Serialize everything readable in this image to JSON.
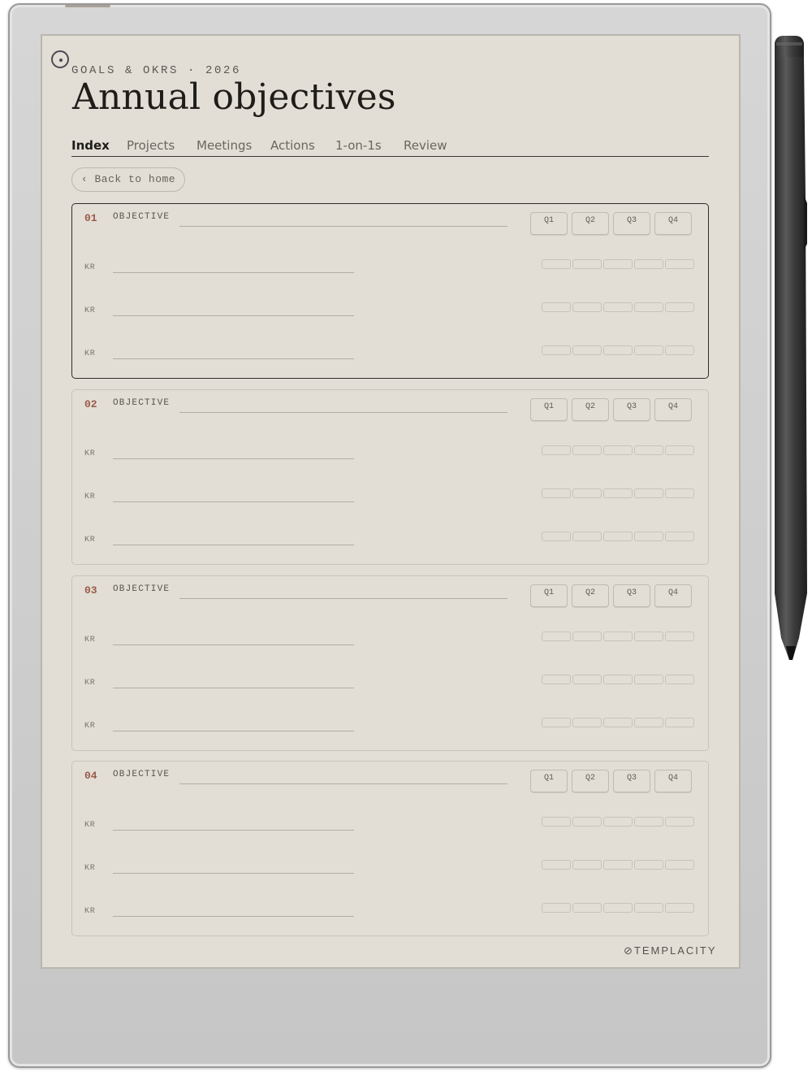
{
  "header": {
    "eyebrow": "GOALS & OKRS · 2026",
    "title": "Annual objectives"
  },
  "tabs": [
    {
      "label": "Index",
      "active": true
    },
    {
      "label": "Projects",
      "active": false
    },
    {
      "label": "Meetings",
      "active": false
    },
    {
      "label": "Actions",
      "active": false
    },
    {
      "label": "1-on-1s",
      "active": false
    },
    {
      "label": "Review",
      "active": false
    }
  ],
  "back_button": {
    "label": "‹ Back to home"
  },
  "objectives": [
    {
      "number": "01",
      "label": "OBJECTIVE",
      "quarters": [
        "Q1",
        "Q2",
        "Q3",
        "Q4"
      ],
      "kr_labels": [
        "KR",
        "KR",
        "KR"
      ]
    },
    {
      "number": "02",
      "label": "OBJECTIVE",
      "quarters": [
        "Q1",
        "Q2",
        "Q3",
        "Q4"
      ],
      "kr_labels": [
        "KR",
        "KR",
        "KR"
      ]
    },
    {
      "number": "03",
      "label": "OBJECTIVE",
      "quarters": [
        "Q1",
        "Q2",
        "Q3",
        "Q4"
      ],
      "kr_labels": [
        "KR",
        "KR",
        "KR"
      ]
    },
    {
      "number": "04",
      "label": "OBJECTIVE",
      "quarters": [
        "Q1",
        "Q2",
        "Q3",
        "Q4"
      ],
      "kr_labels": [
        "KR",
        "KR",
        "KR"
      ]
    }
  ],
  "brand": {
    "name": "TEMPLACITY",
    "icon": "paperclip-icon"
  },
  "colors": {
    "paper": "#e2ded5",
    "ink": "#1f1d1a",
    "accent_number": "#9a5a4a",
    "device_frame": "#d6d6d6"
  }
}
